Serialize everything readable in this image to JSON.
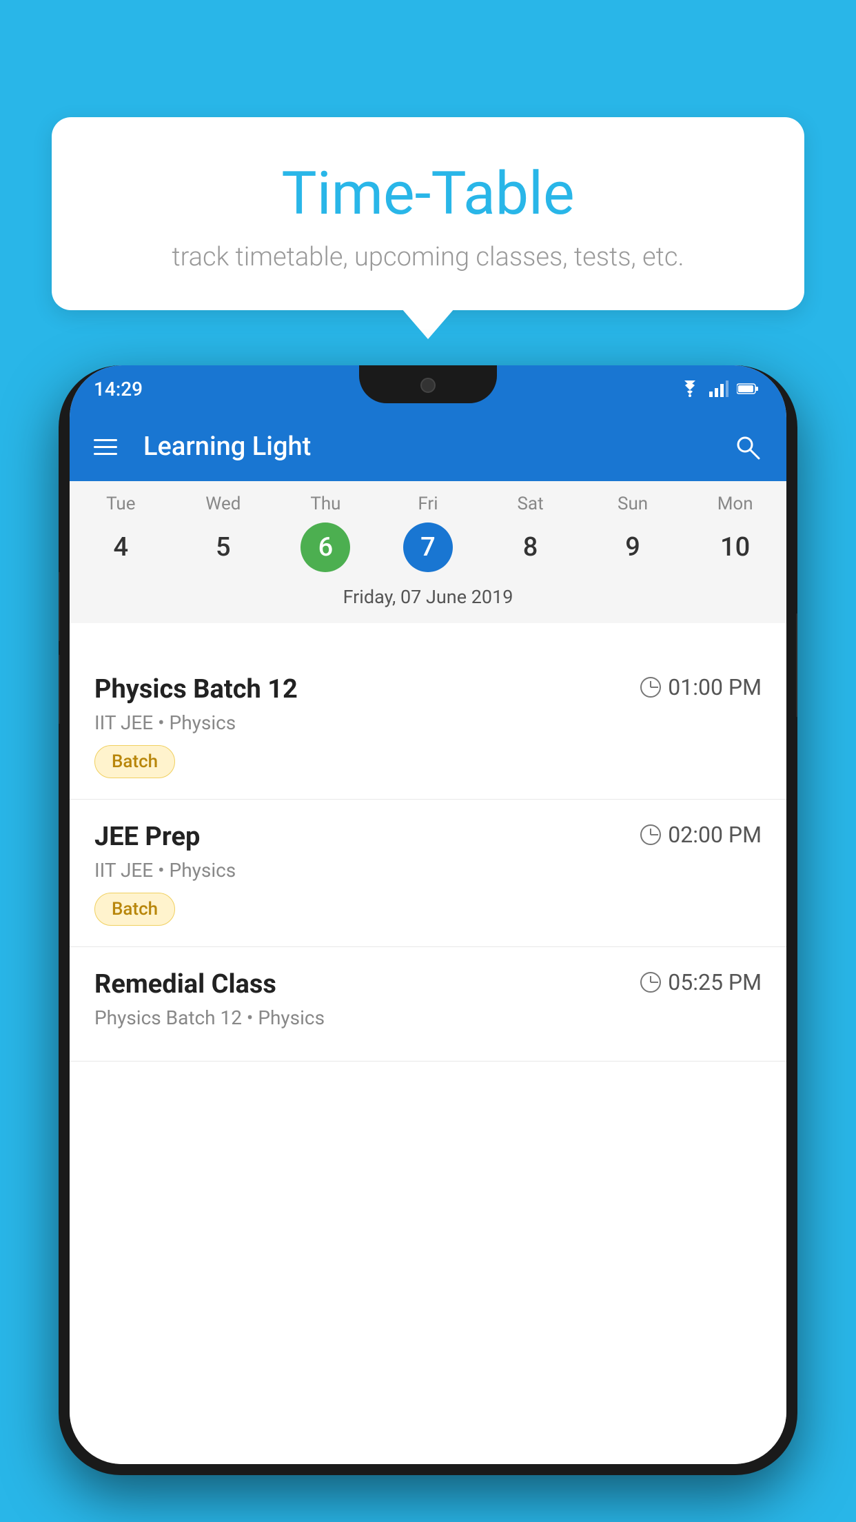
{
  "background_color": "#29B6E8",
  "tooltip": {
    "title": "Time-Table",
    "subtitle": "track timetable, upcoming classes, tests, etc."
  },
  "status_bar": {
    "time": "14:29"
  },
  "app_bar": {
    "title": "Learning Light"
  },
  "calendar": {
    "days": [
      {
        "abbr": "Tue",
        "num": "4"
      },
      {
        "abbr": "Wed",
        "num": "5"
      },
      {
        "abbr": "Thu",
        "num": "6",
        "state": "today"
      },
      {
        "abbr": "Fri",
        "num": "7",
        "state": "selected"
      },
      {
        "abbr": "Sat",
        "num": "8"
      },
      {
        "abbr": "Sun",
        "num": "9"
      },
      {
        "abbr": "Mon",
        "num": "10"
      }
    ],
    "selected_date_label": "Friday, 07 June 2019"
  },
  "schedule": [
    {
      "name": "Physics Batch 12",
      "time": "01:00 PM",
      "meta": "IIT JEE • Physics",
      "tag": "Batch"
    },
    {
      "name": "JEE Prep",
      "time": "02:00 PM",
      "meta": "IIT JEE • Physics",
      "tag": "Batch"
    },
    {
      "name": "Remedial Class",
      "time": "05:25 PM",
      "meta": "Physics Batch 12 • Physics",
      "tag": ""
    }
  ],
  "icons": {
    "hamburger": "≡",
    "search": "🔍"
  }
}
